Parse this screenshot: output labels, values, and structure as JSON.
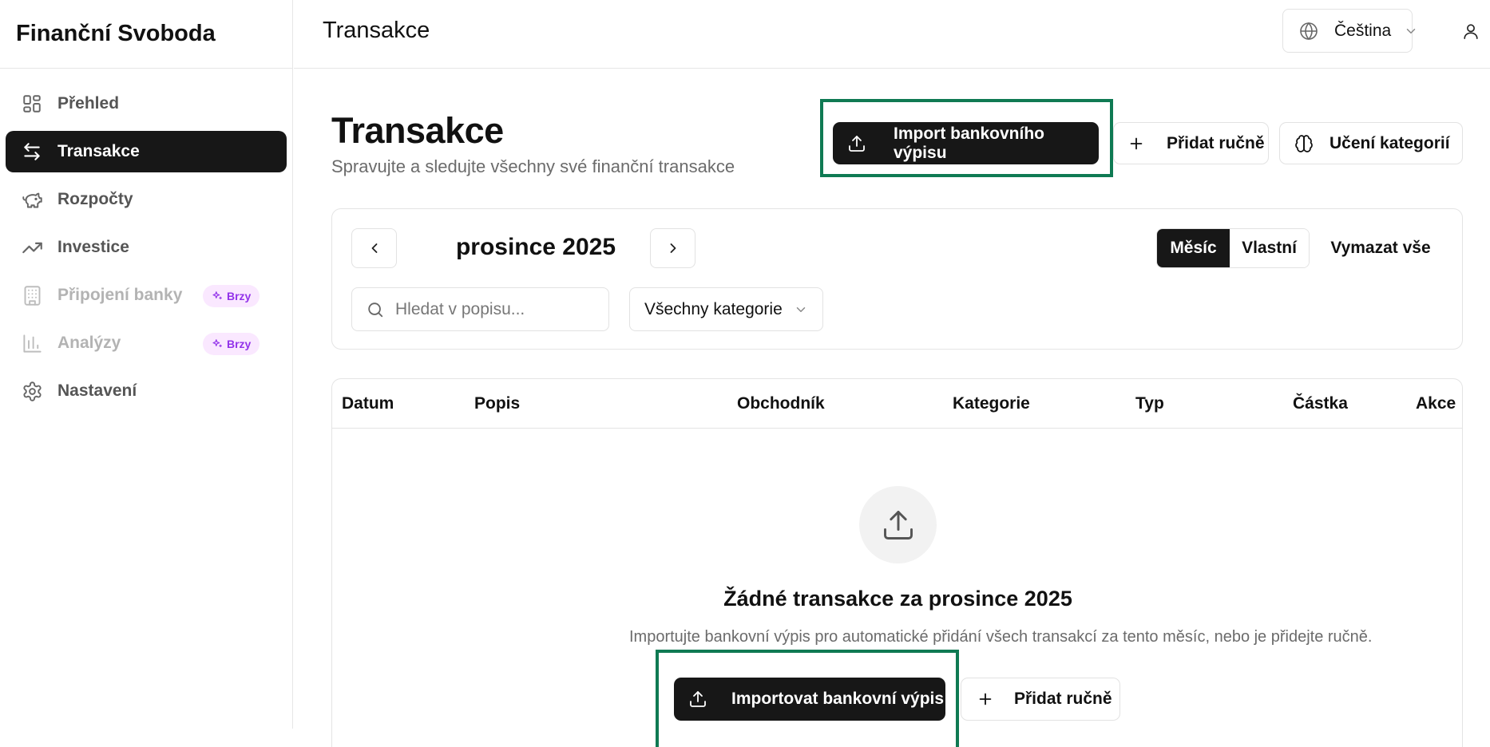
{
  "app": {
    "brand": "Finanční Svoboda"
  },
  "sidebar": {
    "items": [
      {
        "label": "Přehled",
        "icon": "dashboard-icon",
        "state": "normal"
      },
      {
        "label": "Transakce",
        "icon": "arrows-left-right-icon",
        "state": "active"
      },
      {
        "label": "Rozpočty",
        "icon": "piggy-bank-icon",
        "state": "normal"
      },
      {
        "label": "Investice",
        "icon": "trending-up-icon",
        "state": "normal"
      },
      {
        "label": "Připojení banky",
        "icon": "bank-building-icon",
        "state": "disabled",
        "badge": "Brzy"
      },
      {
        "label": "Analýzy",
        "icon": "bar-chart-icon",
        "state": "disabled",
        "badge": "Brzy"
      },
      {
        "label": "Nastavení",
        "icon": "gear-icon",
        "state": "normal"
      }
    ]
  },
  "topbar": {
    "title": "Transakce",
    "language": "Čeština"
  },
  "header": {
    "title": "Transakce",
    "subtitle": "Spravujte a sledujte všechny své finanční transakce",
    "import_label": "Import bankovního výpisu",
    "add_label": "Přidat ručně",
    "learn_label": "Učení kategorií"
  },
  "filters": {
    "month": "prosince 2025",
    "period_options": [
      "Měsíc",
      "Vlastní"
    ],
    "period_selected": "Měsíc",
    "clear_all": "Vymazat vše",
    "search_placeholder": "Hledat v popisu...",
    "category": "Všechny kategorie"
  },
  "table": {
    "columns": [
      "Datum",
      "Popis",
      "Obchodník",
      "Kategorie",
      "Typ",
      "Částka",
      "Akce"
    ]
  },
  "empty_state": {
    "title": "Žádné transakce za prosince 2025",
    "description": "Importujte bankovní výpis pro automatické přidání všech transakcí za tento měsíc, nebo je přidejte ručně.",
    "import_label": "Importovat bankovní výpis",
    "add_label": "Přidat ručně"
  },
  "colors": {
    "accent_dark": "#171717",
    "highlight_border": "#0f7a53",
    "badge_bg": "#fae8ff",
    "badge_text": "#9333ea"
  }
}
